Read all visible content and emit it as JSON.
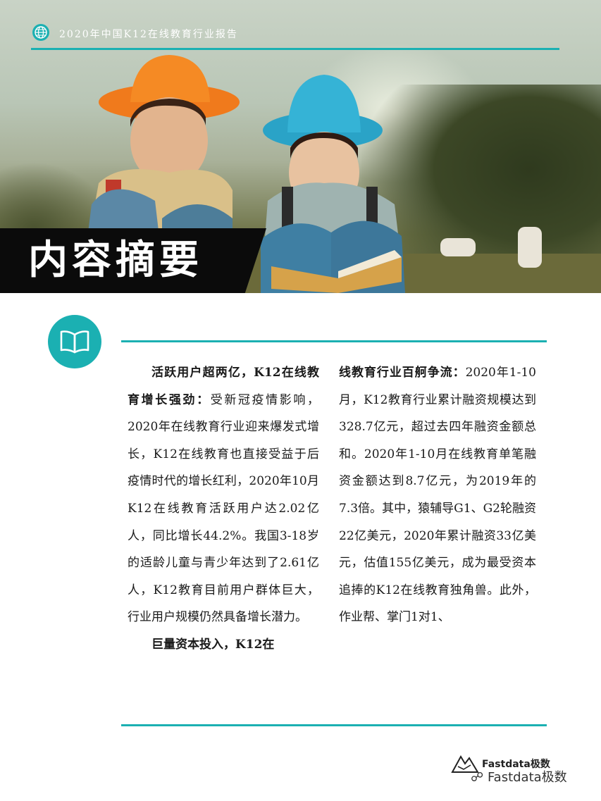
{
  "header": {
    "title": "2020年中国K12在线教育行业报告"
  },
  "banner": {
    "title": "内容摘要"
  },
  "body": {
    "col1_p1_bold": "活跃用户超两亿，K12在线教育增长强劲：",
    "col1_p1_text": "受新冠疫情影响，2020年在线教育行业迎来爆发式增长，K12在线教育也直接受益于后疫情时代的增长红利，2020年10月K12在线教育活跃用户达2.02亿人，同比增长44.2%。我国3-18岁的适龄儿童与青少年达到了2.61亿人，K12教育目前用户群体巨大，行业用户规模仍然具备增长潜力。",
    "col1_p2_bold": "巨量资本投入，K12在",
    "col2_bold": "线教育行业百舸争流：",
    "col2_text": "2020年1-10月，K12教育行业累计融资规模达到328.7亿元，超过去四年融资金额总和。2020年1-10月在线教育单笔融资金额达到8.7亿元，为2019年的7.3倍。其中，猿辅导G1、G2轮融资22亿美元，2020年累计融资33亿美元，估值155亿美元，成为最受资本追捧的K12在线教育独角兽。此外，作业帮、掌门1对1、"
  },
  "footer": {
    "logo_text": "Fastdata极数",
    "wechat_text": "Fastdata极数"
  },
  "colors": {
    "accent": "#1bb0b2",
    "banner_bg": "#0b0b0b"
  },
  "icons": [
    "globe-icon",
    "book-icon",
    "wechat-icon",
    "fastdata-logo"
  ]
}
